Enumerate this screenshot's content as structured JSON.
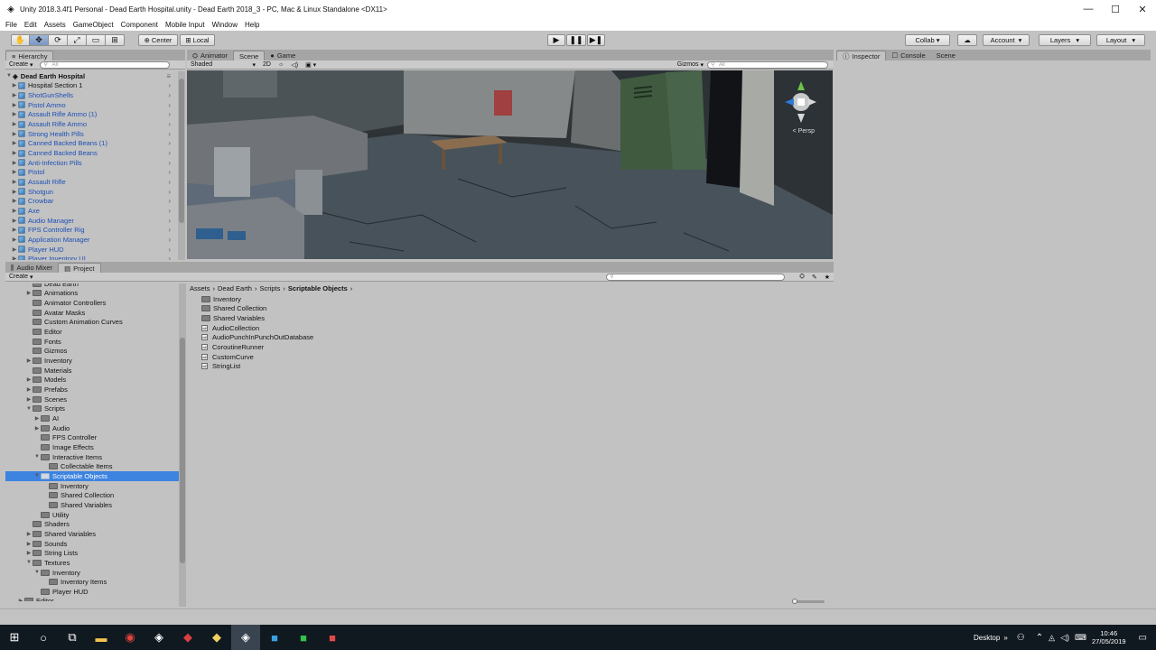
{
  "window": {
    "title": "Unity 2018.3.4f1 Personal - Dead Earth Hospital.unity - Dead Earth 2018_3 - PC, Mac & Linux Standalone <DX11>",
    "minimize": "—",
    "maximize": "☐",
    "close": "✕"
  },
  "menu": [
    "File",
    "Edit",
    "Assets",
    "GameObject",
    "Component",
    "Mobile Input",
    "Window",
    "Help"
  ],
  "toolbar": {
    "pivot": "Center",
    "space": "Local",
    "collab": "Collab ▾",
    "account": "Account",
    "layers": "Layers",
    "layout": "Layout"
  },
  "hierarchy": {
    "tab": "Hierarchy",
    "create": "Create",
    "search_placeholder": "All",
    "scene_name": "Dead Earth Hospital",
    "items": [
      {
        "label": "Hospital Section 1",
        "blue": false
      },
      {
        "label": "ShotGunShells",
        "blue": true
      },
      {
        "label": "Pistol Ammo",
        "blue": true
      },
      {
        "label": "Assault Rifle Ammo (1)",
        "blue": true
      },
      {
        "label": "Assault Rifle Ammo",
        "blue": true
      },
      {
        "label": "Strong Health Pills",
        "blue": true
      },
      {
        "label": "Canned Backed Beans (1)",
        "blue": true
      },
      {
        "label": "Canned Backed Beans",
        "blue": true
      },
      {
        "label": "Anti-Infection Pills",
        "blue": true
      },
      {
        "label": "Pistol",
        "blue": true
      },
      {
        "label": "Assault Rifle",
        "blue": true
      },
      {
        "label": "Shotgun",
        "blue": true
      },
      {
        "label": "Crowbar",
        "blue": true
      },
      {
        "label": "Axe",
        "blue": true
      },
      {
        "label": "Audio Manager",
        "blue": true
      },
      {
        "label": "FPS Controller Rig",
        "blue": true
      },
      {
        "label": "Application Manager",
        "blue": true
      },
      {
        "label": "Player HUD",
        "blue": true
      },
      {
        "label": "Player Inventory UI",
        "blue": true
      }
    ]
  },
  "scene_view": {
    "tabs": [
      "Animator",
      "Scene",
      "Game"
    ],
    "shading": "Shaded",
    "mode_2d": "2D",
    "gizmos": "Gizmos",
    "search_placeholder": "All",
    "persp_label": "< Persp"
  },
  "inspector": {
    "tabs": [
      "Inspector",
      "Console",
      "Scene"
    ]
  },
  "bottom": {
    "tabs": [
      "Audio Mixer",
      "Project"
    ],
    "create": "Create"
  },
  "project_tree": [
    {
      "label": "Dead Earth",
      "indent": 2,
      "arrow": ""
    },
    {
      "label": "Animations",
      "indent": 2,
      "arrow": "▶"
    },
    {
      "label": "Animator Controllers",
      "indent": 2,
      "arrow": ""
    },
    {
      "label": "Avatar Masks",
      "indent": 2,
      "arrow": ""
    },
    {
      "label": "Custom Animation Curves",
      "indent": 2,
      "arrow": ""
    },
    {
      "label": "Editor",
      "indent": 2,
      "arrow": ""
    },
    {
      "label": "Fonts",
      "indent": 2,
      "arrow": ""
    },
    {
      "label": "Gizmos",
      "indent": 2,
      "arrow": ""
    },
    {
      "label": "Inventory",
      "indent": 2,
      "arrow": "▶"
    },
    {
      "label": "Materials",
      "indent": 2,
      "arrow": ""
    },
    {
      "label": "Models",
      "indent": 2,
      "arrow": "▶"
    },
    {
      "label": "Prefabs",
      "indent": 2,
      "arrow": "▶"
    },
    {
      "label": "Scenes",
      "indent": 2,
      "arrow": "▶"
    },
    {
      "label": "Scripts",
      "indent": 2,
      "arrow": "▼"
    },
    {
      "label": "AI",
      "indent": 3,
      "arrow": "▶"
    },
    {
      "label": "Audio",
      "indent": 3,
      "arrow": "▶"
    },
    {
      "label": "FPS Controller",
      "indent": 3,
      "arrow": ""
    },
    {
      "label": "Image Effects",
      "indent": 3,
      "arrow": ""
    },
    {
      "label": "Interactive Items",
      "indent": 3,
      "arrow": "▼"
    },
    {
      "label": "Collectable Items",
      "indent": 4,
      "arrow": ""
    },
    {
      "label": "Scriptable Objects",
      "indent": 3,
      "arrow": "▼",
      "selected": true
    },
    {
      "label": "Inventory",
      "indent": 4,
      "arrow": ""
    },
    {
      "label": "Shared Collection",
      "indent": 4,
      "arrow": ""
    },
    {
      "label": "Shared Variables",
      "indent": 4,
      "arrow": ""
    },
    {
      "label": "Utility",
      "indent": 3,
      "arrow": ""
    },
    {
      "label": "Shaders",
      "indent": 2,
      "arrow": ""
    },
    {
      "label": "Shared Variables",
      "indent": 2,
      "arrow": "▶"
    },
    {
      "label": "Sounds",
      "indent": 2,
      "arrow": "▶"
    },
    {
      "label": "String Lists",
      "indent": 2,
      "arrow": "▶"
    },
    {
      "label": "Textures",
      "indent": 2,
      "arrow": "▼"
    },
    {
      "label": "Inventory",
      "indent": 3,
      "arrow": "▼"
    },
    {
      "label": "Inventory Items",
      "indent": 4,
      "arrow": ""
    },
    {
      "label": "Player HUD",
      "indent": 3,
      "arrow": ""
    },
    {
      "label": "Editor",
      "indent": 1,
      "arrow": "▶"
    }
  ],
  "breadcrumb": [
    "Assets",
    "Dead Earth",
    "Scripts",
    "Scriptable Objects"
  ],
  "assets": [
    {
      "label": "Inventory",
      "kind": "folder"
    },
    {
      "label": "Shared Collection",
      "kind": "folder"
    },
    {
      "label": "Shared Variables",
      "kind": "folder"
    },
    {
      "label": "AudioCollection",
      "kind": "script"
    },
    {
      "label": "AudioPunchInPunchOutDatabase",
      "kind": "script"
    },
    {
      "label": "CoroutineRunner",
      "kind": "script"
    },
    {
      "label": "CustomCurve",
      "kind": "script"
    },
    {
      "label": "StringList",
      "kind": "script"
    }
  ],
  "taskbar": {
    "desktop": "Desktop",
    "time": "10:46",
    "date": "27/05/2019"
  }
}
